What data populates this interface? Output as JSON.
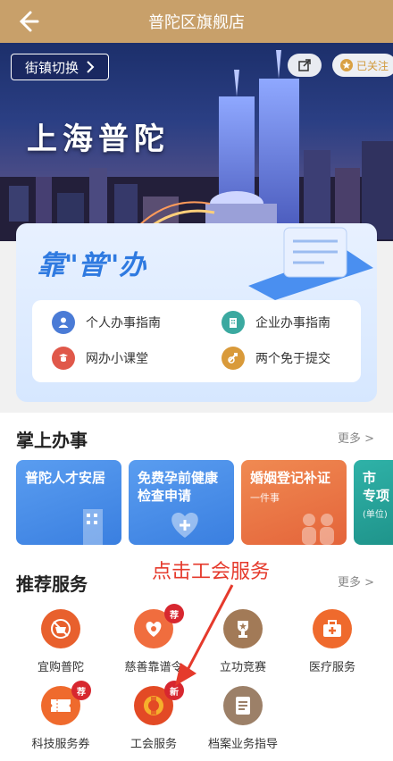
{
  "header": {
    "title": "普陀区旗舰店",
    "back_icon": "back-arrow-icon"
  },
  "hero": {
    "switch_label": "街镇切换",
    "follow_label": "已关注",
    "brand_text": "上海普陀"
  },
  "panel": {
    "slogan": "靠\"普\"办",
    "items": [
      {
        "label": "个人办事指南",
        "icon": "person-icon",
        "color": "#4a7bd6"
      },
      {
        "label": "企业办事指南",
        "icon": "building-icon",
        "color": "#3ba9a0"
      },
      {
        "label": "网办小课堂",
        "icon": "classroom-icon",
        "color": "#e0584a"
      },
      {
        "label": "两个免于提交",
        "icon": "exempt-icon",
        "color": "#d99a3a"
      }
    ]
  },
  "palm": {
    "title": "掌上办事",
    "more": "更多 >",
    "cards": [
      {
        "line1": "普陀人才安居",
        "line2": "",
        "color": "#4a8ee8"
      },
      {
        "line1": "免费孕前健康",
        "line1b": "检查申请",
        "line2": "",
        "color": "#3f8ae8"
      },
      {
        "line1": "婚姻登记补证",
        "line2": "一件事",
        "color": "#e8743e"
      },
      {
        "line1": "市",
        "line1b": "专项",
        "line2": "(单位)",
        "color": "#24a39b"
      }
    ]
  },
  "recommend": {
    "title": "推荐服务",
    "more": "更多 >",
    "services": [
      {
        "label": "宜购普陀",
        "icon": "shopping-icon",
        "color": "#e8602d",
        "badge": ""
      },
      {
        "label": "慈善靠谱令",
        "icon": "charity-heart-icon",
        "color": "#f06d3e",
        "badge": "荐"
      },
      {
        "label": "立功竞赛",
        "icon": "trophy-icon",
        "color": "#a27a57",
        "badge": ""
      },
      {
        "label": "医疗服务",
        "icon": "medical-kit-icon",
        "color": "#ef6a2d",
        "badge": ""
      },
      {
        "label": "科技服务券",
        "icon": "ticket-icon",
        "color": "#ef6a2d",
        "badge": "荐"
      },
      {
        "label": "工会服务",
        "icon": "union-emblem-icon",
        "color": "#e34a25",
        "badge": "新"
      },
      {
        "label": "档案业务指导",
        "icon": "archive-icon",
        "color": "#9c8068",
        "badge": ""
      }
    ]
  },
  "annotation": {
    "text": "点击工会服务"
  }
}
